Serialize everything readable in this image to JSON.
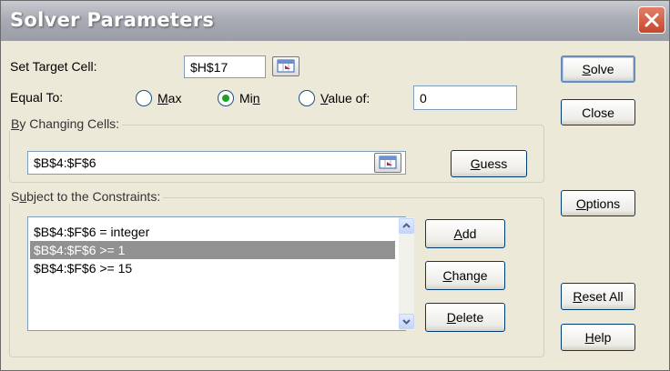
{
  "window": {
    "title": "Solver Parameters"
  },
  "target": {
    "label": "Set Target Cell:",
    "value": "$H$17"
  },
  "equal_to": {
    "label": "Equal To:",
    "options": [
      {
        "label": "Max",
        "selected": false
      },
      {
        "label": "Min",
        "selected": true
      },
      {
        "label": "Value of:",
        "selected": false
      }
    ],
    "value_of": "0"
  },
  "changing": {
    "group_label": "By Changing Cells:",
    "value": "$B$4:$F$6",
    "guess_label": "Guess"
  },
  "constraints": {
    "group_label": "Subject to the Constraints:",
    "items": [
      "$B$4:$F$6 = integer",
      "$B$4:$F$6 >= 1",
      "$B$4:$F$6 >= 15"
    ],
    "selected_index": 1,
    "buttons": {
      "add": "Add",
      "change": "Change",
      "delete": "Delete"
    }
  },
  "side_buttons": {
    "solve": "Solve",
    "close": "Close",
    "options": "Options",
    "reset_all": "Reset All",
    "help": "Help"
  },
  "icons": {
    "close": "close-icon",
    "collapse": "collapse-dialog-icon",
    "scroll_up": "chevron-up-icon",
    "scroll_down": "chevron-down-icon"
  },
  "colors": {
    "title_bar": "#a9acb4",
    "close_button": "#c8462d",
    "selection": "#919191",
    "dialog_bg": "#ECE9D8"
  }
}
